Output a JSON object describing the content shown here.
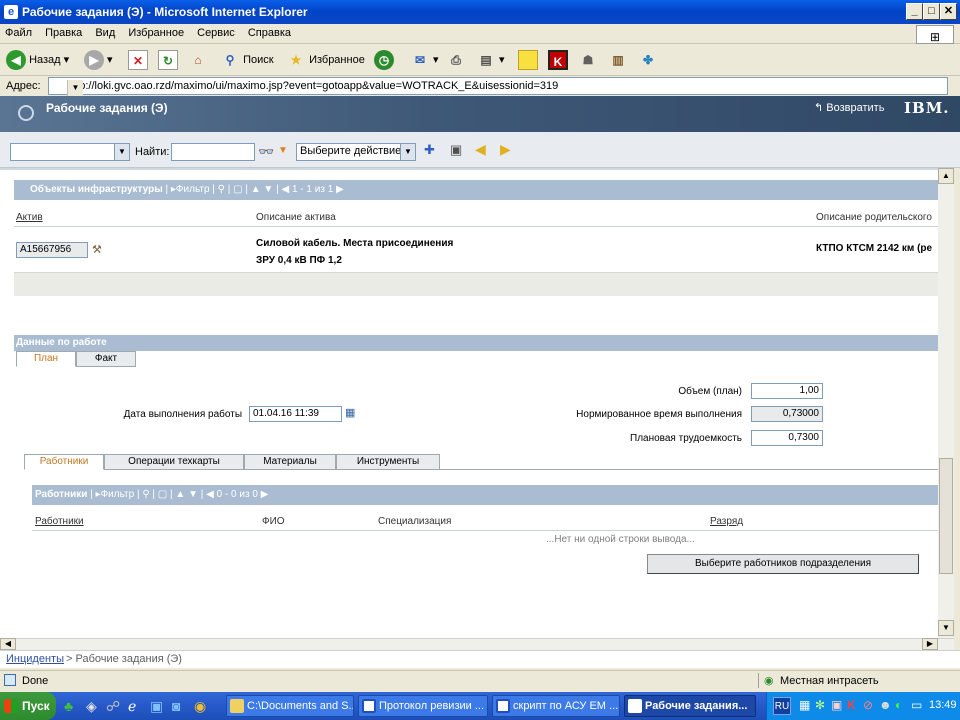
{
  "window": {
    "title": "Рабочие задания (Э) - Microsoft Internet Explorer"
  },
  "menu": [
    "Файл",
    "Правка",
    "Вид",
    "Избранное",
    "Сервис",
    "Справка"
  ],
  "toolbar": {
    "back": "Назад",
    "search": "Поиск",
    "favorites": "Избранное"
  },
  "address": {
    "label": "Адрес:",
    "url": "http://loki.gvc.oao.rzd/maximo/ui/maximo.jsp?event=gotoapp&value=WOTRACK_E&uisessionid=319"
  },
  "app": {
    "title": "Рабочие задания (Э)",
    "return_label": "Возвратить",
    "brand": "IBM."
  },
  "apptool": {
    "find_label": "Найти:",
    "action_placeholder": "Выберите действие"
  },
  "assets": {
    "title": "Объекты инфраструктуры",
    "filter": "Фильтр",
    "pager": "1 - 1 из 1",
    "columns": [
      "Актив",
      "Описание актива",
      "Описание родительского"
    ],
    "row": {
      "asset": "А15667956",
      "desc_line1": "Силовой кабель. Места присоединения",
      "desc_line2": "ЗРУ 0,4 кВ ПФ 1,2",
      "parent": "КТПО КТСМ 2142 км (ре"
    }
  },
  "work": {
    "title": "Данные по работе",
    "subtabs": [
      "План",
      "Факт"
    ],
    "volume_label": "Объем (план)",
    "volume_value": "1,00",
    "date_label": "Дата выполнения работы",
    "date_value": "01.04.16 11:39",
    "normtime_label": "Нормированное время выполнения",
    "normtime_value": "0,73000",
    "labor_label": "Плановая трудоемкость",
    "labor_value": "0,7300"
  },
  "tabs": [
    "Работники",
    "Операции техкарты",
    "Материалы",
    "Инструменты"
  ],
  "workers": {
    "title": "Работники",
    "filter": "Фильтр",
    "pager": "0 - 0 из 0",
    "columns": [
      "Работники",
      "ФИО",
      "Специализация",
      "Разряд"
    ],
    "empty": "...Нет ни одной строки вывода...",
    "select_button": "Выберите работников подразделения"
  },
  "breadcrumb": {
    "link": "Инциденты",
    "current": "> Рабочие задания (Э)"
  },
  "status": {
    "left": "Done",
    "zone": "Местная интрасеть"
  },
  "taskbar": {
    "start": "Пуск",
    "items": [
      "C:\\Documents and S...",
      "Протокол ревизии ...",
      "скрипт по АСУ ЕМ ...",
      "Рабочие задания..."
    ],
    "lang": "RU",
    "clock": "13:49"
  }
}
